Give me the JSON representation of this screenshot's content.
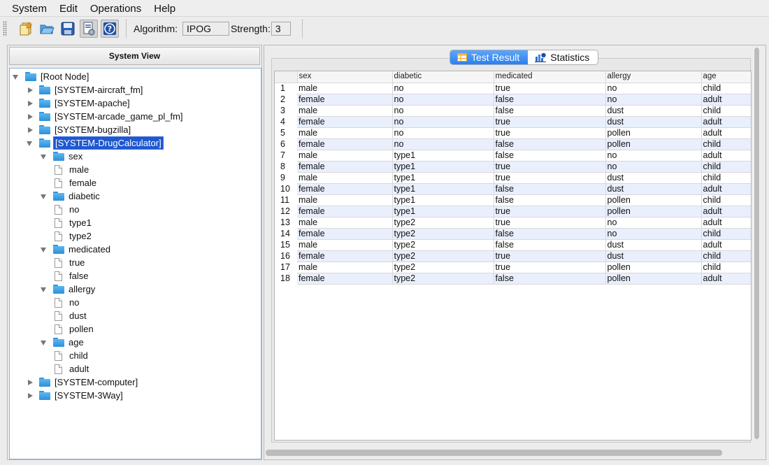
{
  "menu": [
    "System",
    "Edit",
    "Operations",
    "Help"
  ],
  "toolbar": {
    "buttons": [
      "new-project-icon",
      "open-folder-icon",
      "save-disk-icon",
      "generate-icon",
      "help-icon"
    ],
    "algorithm_label": "Algorithm:",
    "algorithm_value": "IPOG",
    "strength_label": "Strength:",
    "strength_value": "3"
  },
  "system_view": {
    "title": "System View",
    "tree": [
      {
        "label": "[Root Node]"
      },
      {
        "label": "[SYSTEM-aircraft_fm]"
      },
      {
        "label": "[SYSTEM-apache]"
      },
      {
        "label": "[SYSTEM-arcade_game_pl_fm]"
      },
      {
        "label": "[SYSTEM-bugzilla]"
      },
      {
        "label": "[SYSTEM-DrugCalculator]"
      },
      {
        "label": "sex"
      },
      {
        "label": "male"
      },
      {
        "label": "female"
      },
      {
        "label": "diabetic"
      },
      {
        "label": "no"
      },
      {
        "label": "type1"
      },
      {
        "label": "type2"
      },
      {
        "label": "medicated"
      },
      {
        "label": "true"
      },
      {
        "label": "false"
      },
      {
        "label": "allergy"
      },
      {
        "label": "no"
      },
      {
        "label": "dust"
      },
      {
        "label": "pollen"
      },
      {
        "label": "age"
      },
      {
        "label": "child"
      },
      {
        "label": "adult"
      },
      {
        "label": "[SYSTEM-computer]"
      },
      {
        "label": "[SYSTEM-3Way]"
      }
    ]
  },
  "tabs": {
    "test_result": "Test Result",
    "statistics": "Statistics"
  },
  "table": {
    "columns": [
      "sex",
      "diabetic",
      "medicated",
      "allergy",
      "age"
    ],
    "rows": [
      [
        "1",
        "male",
        "no",
        "true",
        "no",
        "child"
      ],
      [
        "2",
        "female",
        "no",
        "false",
        "no",
        "adult"
      ],
      [
        "3",
        "male",
        "no",
        "false",
        "dust",
        "child"
      ],
      [
        "4",
        "female",
        "no",
        "true",
        "dust",
        "adult"
      ],
      [
        "5",
        "male",
        "no",
        "true",
        "pollen",
        "adult"
      ],
      [
        "6",
        "female",
        "no",
        "false",
        "pollen",
        "child"
      ],
      [
        "7",
        "male",
        "type1",
        "false",
        "no",
        "adult"
      ],
      [
        "8",
        "female",
        "type1",
        "true",
        "no",
        "child"
      ],
      [
        "9",
        "male",
        "type1",
        "true",
        "dust",
        "child"
      ],
      [
        "10",
        "female",
        "type1",
        "false",
        "dust",
        "adult"
      ],
      [
        "11",
        "male",
        "type1",
        "false",
        "pollen",
        "child"
      ],
      [
        "12",
        "female",
        "type1",
        "true",
        "pollen",
        "adult"
      ],
      [
        "13",
        "male",
        "type2",
        "true",
        "no",
        "adult"
      ],
      [
        "14",
        "female",
        "type2",
        "false",
        "no",
        "child"
      ],
      [
        "15",
        "male",
        "type2",
        "false",
        "dust",
        "adult"
      ],
      [
        "16",
        "female",
        "type2",
        "true",
        "dust",
        "child"
      ],
      [
        "17",
        "male",
        "type2",
        "true",
        "pollen",
        "child"
      ],
      [
        "18",
        "female",
        "type2",
        "false",
        "pollen",
        "adult"
      ]
    ]
  }
}
